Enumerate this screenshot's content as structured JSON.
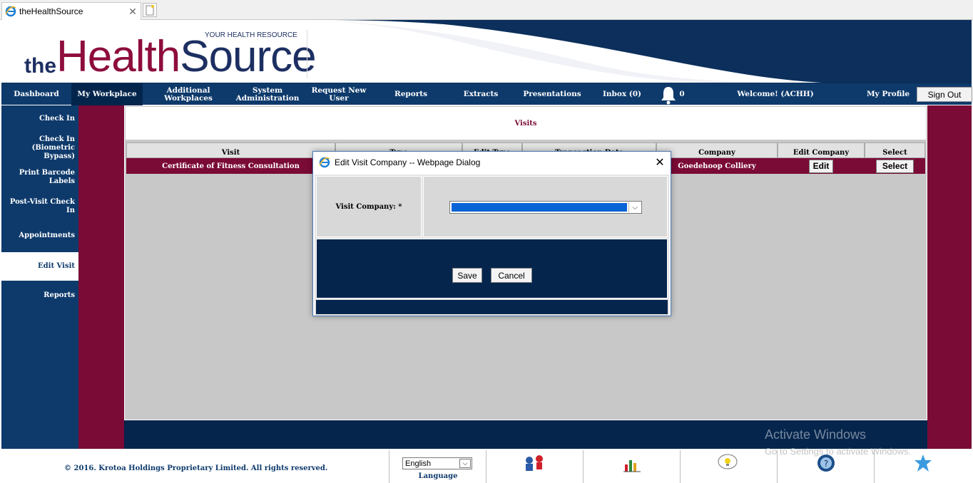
{
  "browser": {
    "tab_title": "theHealthSource"
  },
  "header": {
    "logo_the": "the",
    "logo_health": "Health",
    "logo_source": "Source",
    "tagline": "YOUR HEALTH RESOURCE"
  },
  "nav": {
    "items": [
      {
        "label": "Dashboard"
      },
      {
        "label": "My Workplace"
      },
      {
        "label": "Additional Workplaces"
      },
      {
        "label": "System Administration"
      },
      {
        "label": "Request New User"
      },
      {
        "label": "Reports"
      },
      {
        "label": "Extracts"
      },
      {
        "label": "Presentations"
      },
      {
        "label": "Inbox (0)"
      }
    ],
    "notification_count": "0",
    "welcome": "Welcome! (ACHH)",
    "my_profile": "My Profile",
    "sign_out": "Sign Out"
  },
  "sidebar": {
    "items": [
      {
        "label": "Check In"
      },
      {
        "label": "Check In (Biometric Bypass)"
      },
      {
        "label": "Print Barcode Labels"
      },
      {
        "label": "Post-Visit Check In"
      },
      {
        "label": "Appointments"
      },
      {
        "label": "Edit Visit"
      },
      {
        "label": "Reports"
      }
    ]
  },
  "main": {
    "title": "Visits",
    "columns": [
      "Visit",
      "Type",
      "Edit Type",
      "Transaction Date",
      "Company",
      "Edit Company",
      "Select"
    ],
    "row": {
      "visit": "Certificate of Fitness Consultation",
      "company": "Goedehoop Colliery",
      "edit_button": "Edit",
      "select_button": "Select"
    }
  },
  "dialog": {
    "title": "Edit Visit Company -- Webpage Dialog",
    "field_label": "Visit Company: *",
    "save": "Save",
    "cancel": "Cancel"
  },
  "footer": {
    "copyright": "© 2016. Krotoa Holdings Proprietary Limited. All rights reserved.",
    "language_value": "English",
    "language_label": "Language"
  },
  "watermark": {
    "line1": "Activate Windows",
    "line2": "Go to Settings to activate Windows."
  }
}
